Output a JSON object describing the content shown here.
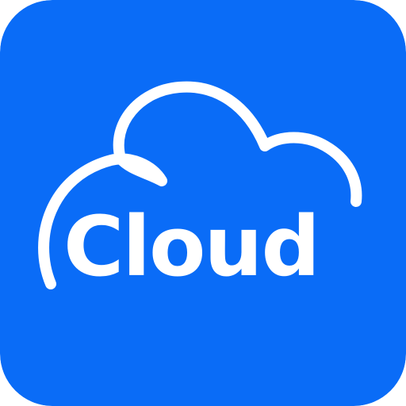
{
  "icon": {
    "label": "Cloud",
    "icon_name": "cloud-icon",
    "colors": {
      "background": "#0a6cf7",
      "foreground": "#ffffff"
    }
  }
}
